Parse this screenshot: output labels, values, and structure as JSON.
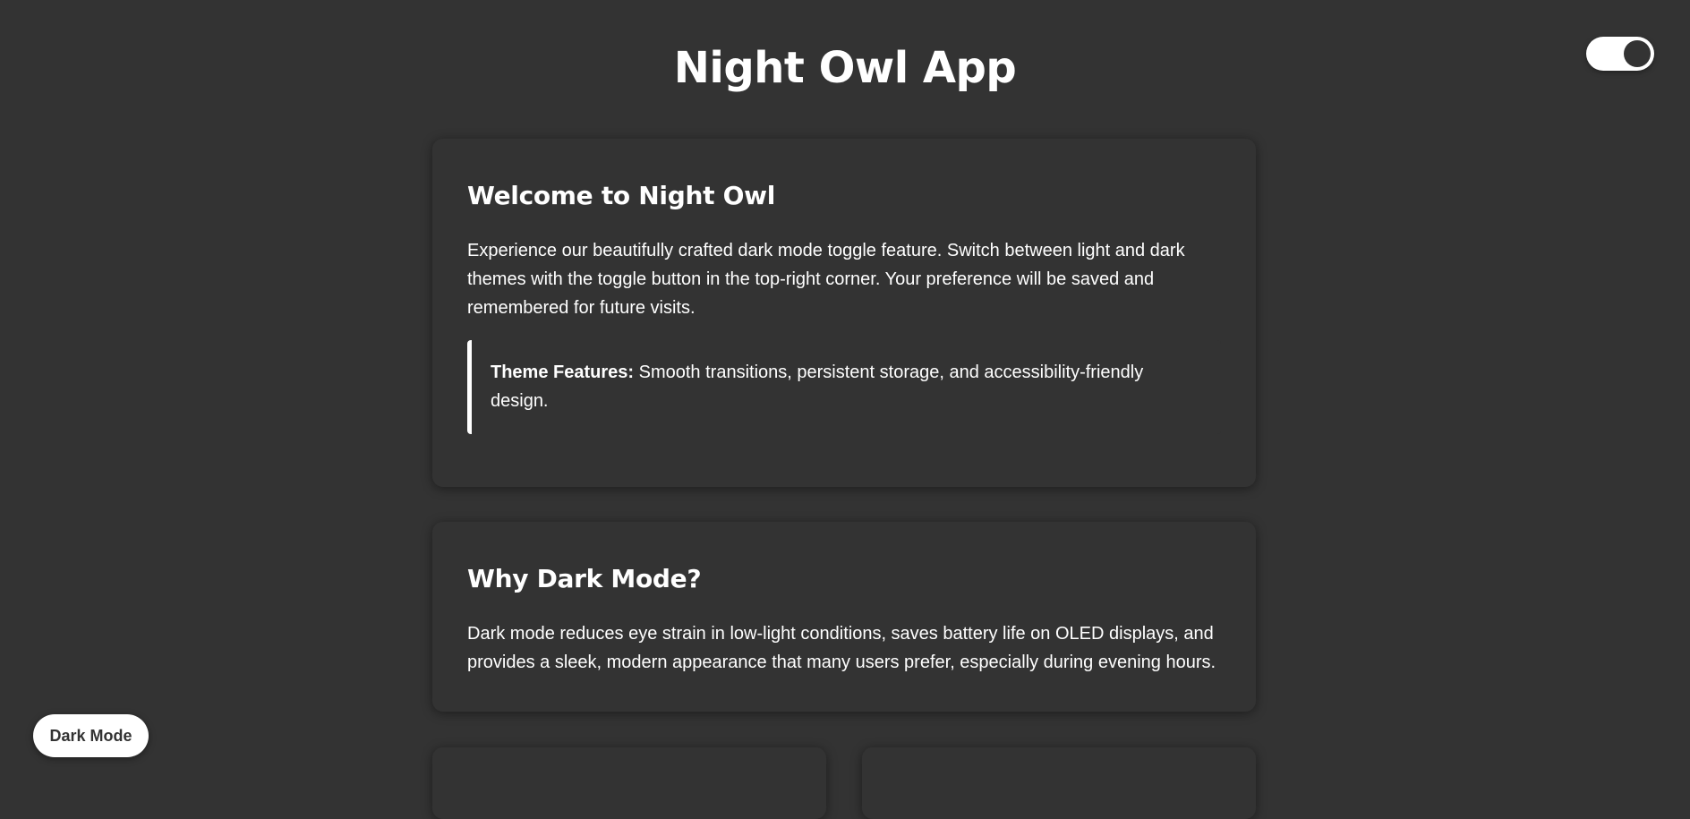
{
  "header": {
    "title": "Night Owl App"
  },
  "theme_toggle": {
    "state": "dark",
    "icon": "toggle-switch-icon"
  },
  "cards": {
    "welcome": {
      "heading": "Welcome to Night Owl",
      "body": "Experience our beautifully crafted dark mode toggle feature. Switch between light and dark themes with the toggle button in the top-right corner. Your preference will be saved and remembered for future visits.",
      "feature": {
        "label": "Theme Features:",
        "text": " Smooth transitions, persistent storage, and accessibility-friendly design."
      }
    },
    "why": {
      "heading": "Why Dark Mode?",
      "body": "Dark mode reduces eye strain in low-light conditions, saves battery life on OLED displays, and provides a sleek, modern appearance that many users prefer, especially during evening hours."
    }
  },
  "mode_button": {
    "label": "Dark Mode"
  },
  "colors": {
    "background": "#333333",
    "text": "#ffffff",
    "accent": "#ffffff"
  }
}
